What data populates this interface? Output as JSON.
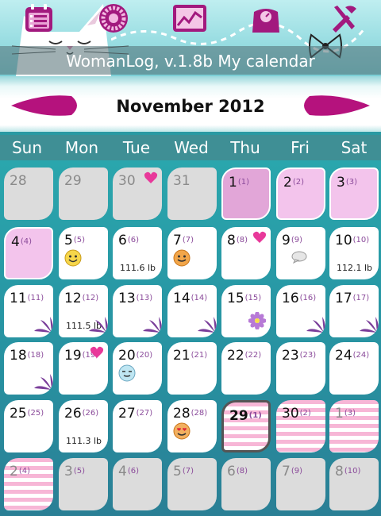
{
  "app_title": "WomanLog, v.1.8b My calendar",
  "month_label": "November 2012",
  "weekdays": [
    "Sun",
    "Mon",
    "Tue",
    "Wed",
    "Thu",
    "Fri",
    "Sat"
  ],
  "toolbar": [
    "calendar-list-icon",
    "cycle-wheel-icon",
    "chart-icon",
    "weight-scale-icon",
    "tools-icon"
  ],
  "colors": {
    "accent": "#b5127d",
    "period": "#e2a6d8",
    "fertile": "#f7b6d6",
    "teal": "#2aa6ad"
  },
  "weeks": [
    [
      {
        "day": "28",
        "cycle": "",
        "type": "other"
      },
      {
        "day": "29",
        "cycle": "",
        "type": "other"
      },
      {
        "day": "30",
        "cycle": "",
        "type": "other",
        "icon": "heart-icon"
      },
      {
        "day": "31",
        "cycle": "",
        "type": "other"
      },
      {
        "day": "1",
        "cycle": "(1)",
        "type": "pink"
      },
      {
        "day": "2",
        "cycle": "(2)",
        "type": "lightpink"
      },
      {
        "day": "3",
        "cycle": "(3)",
        "type": "lightpink"
      }
    ],
    [
      {
        "day": "4",
        "cycle": "(4)",
        "type": "lightpink"
      },
      {
        "day": "5",
        "cycle": "(5)",
        "type": "normal",
        "icon": "smiley-icon"
      },
      {
        "day": "6",
        "cycle": "(6)",
        "type": "normal",
        "weight": "111.6 lb"
      },
      {
        "day": "7",
        "cycle": "(7)",
        "type": "normal",
        "icon": "smiley-orange-icon"
      },
      {
        "day": "8",
        "cycle": "(8)",
        "type": "normal",
        "icon": "heart-icon"
      },
      {
        "day": "9",
        "cycle": "(9)",
        "type": "normal",
        "icon": "note-bubble-icon"
      },
      {
        "day": "10",
        "cycle": "(10)",
        "type": "normal",
        "weight": "112.1 lb"
      }
    ],
    [
      {
        "day": "11",
        "cycle": "(11)",
        "type": "normal",
        "icon": "fertile-flower-icon"
      },
      {
        "day": "12",
        "cycle": "(12)",
        "type": "normal",
        "weight": "111.5 lb",
        "icon": "fertile-flower-icon"
      },
      {
        "day": "13",
        "cycle": "(13)",
        "type": "normal",
        "icon": "fertile-flower-icon"
      },
      {
        "day": "14",
        "cycle": "(14)",
        "type": "normal",
        "icon": "fertile-flower-icon"
      },
      {
        "day": "15",
        "cycle": "(15)",
        "type": "normal",
        "icon": "ovulation-flower-icon"
      },
      {
        "day": "16",
        "cycle": "(16)",
        "type": "normal",
        "icon": "fertile-flower-icon"
      },
      {
        "day": "17",
        "cycle": "(17)",
        "type": "normal",
        "icon": "fertile-flower-icon"
      }
    ],
    [
      {
        "day": "18",
        "cycle": "(18)",
        "type": "normal",
        "icon": "fertile-flower-icon"
      },
      {
        "day": "19",
        "cycle": "(19)",
        "type": "normal",
        "icon": "heart-icon"
      },
      {
        "day": "20",
        "cycle": "(20)",
        "type": "normal",
        "icon": "smiley-sleepy-icon"
      },
      {
        "day": "21",
        "cycle": "(21)",
        "type": "normal"
      },
      {
        "day": "22",
        "cycle": "(22)",
        "type": "normal"
      },
      {
        "day": "23",
        "cycle": "(23)",
        "type": "normal"
      },
      {
        "day": "24",
        "cycle": "(24)",
        "type": "normal"
      }
    ],
    [
      {
        "day": "25",
        "cycle": "(25)",
        "type": "normal"
      },
      {
        "day": "26",
        "cycle": "(26)",
        "type": "normal",
        "weight": "111.3 lb"
      },
      {
        "day": "27",
        "cycle": "(27)",
        "type": "normal"
      },
      {
        "day": "28",
        "cycle": "(28)",
        "type": "normal",
        "icon": "smiley-love-icon"
      },
      {
        "day": "29",
        "cycle": "(1)",
        "type": "today-stripes"
      },
      {
        "day": "30",
        "cycle": "(2)",
        "type": "stripes"
      },
      {
        "day": "1",
        "cycle": "(3)",
        "type": "stripes-other"
      }
    ],
    [
      {
        "day": "2",
        "cycle": "(4)",
        "type": "stripes-other"
      },
      {
        "day": "3",
        "cycle": "(5)",
        "type": "other"
      },
      {
        "day": "4",
        "cycle": "(6)",
        "type": "other"
      },
      {
        "day": "5",
        "cycle": "(7)",
        "type": "other"
      },
      {
        "day": "6",
        "cycle": "(8)",
        "type": "other"
      },
      {
        "day": "7",
        "cycle": "(9)",
        "type": "other"
      },
      {
        "day": "8",
        "cycle": "(10)",
        "type": "other"
      }
    ]
  ]
}
